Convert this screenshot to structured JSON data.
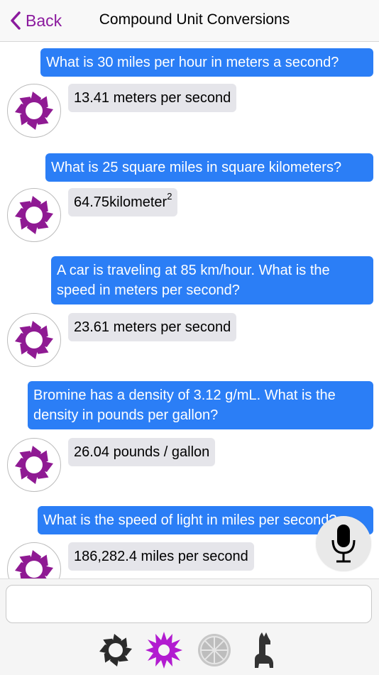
{
  "header": {
    "back_label": "Back",
    "title": "Compound Unit Conversions"
  },
  "messages": [
    {
      "role": "user",
      "text": "What is 30 miles per hour in meters a second?"
    },
    {
      "role": "bot",
      "text": "13.41 meters per second"
    },
    {
      "role": "user",
      "text": "What is 25 square miles in square kilometers?"
    },
    {
      "role": "bot",
      "value": "64.75",
      "unit": "kilometer",
      "exponent": "2"
    },
    {
      "role": "user",
      "line1": "A car is traveling at 85 km/hour.  What is the",
      "line2": "speed in meters per second?"
    },
    {
      "role": "bot",
      "text": "23.61 meters per second"
    },
    {
      "role": "user",
      "line1": "Bromine has a density of 3.12 g/mL. What is the",
      "line2": "density in pounds per gallon?"
    },
    {
      "role": "bot",
      "text": "26.04 pounds / gallon"
    },
    {
      "role": "user",
      "text": "What is the speed of light in miles per second?"
    },
    {
      "role": "bot",
      "text": "186,282.4 miles per second"
    }
  ],
  "input": {
    "value": "",
    "placeholder": ""
  },
  "tabs": [
    {
      "icon": "dark-flower-icon"
    },
    {
      "icon": "purple-star-icon"
    },
    {
      "icon": "citrus-icon"
    },
    {
      "icon": "llama-icon"
    }
  ],
  "colors": {
    "accent": "#8b1a9e",
    "user_bubble": "#2b7ef6",
    "bot_bubble": "#e5e5ea"
  }
}
